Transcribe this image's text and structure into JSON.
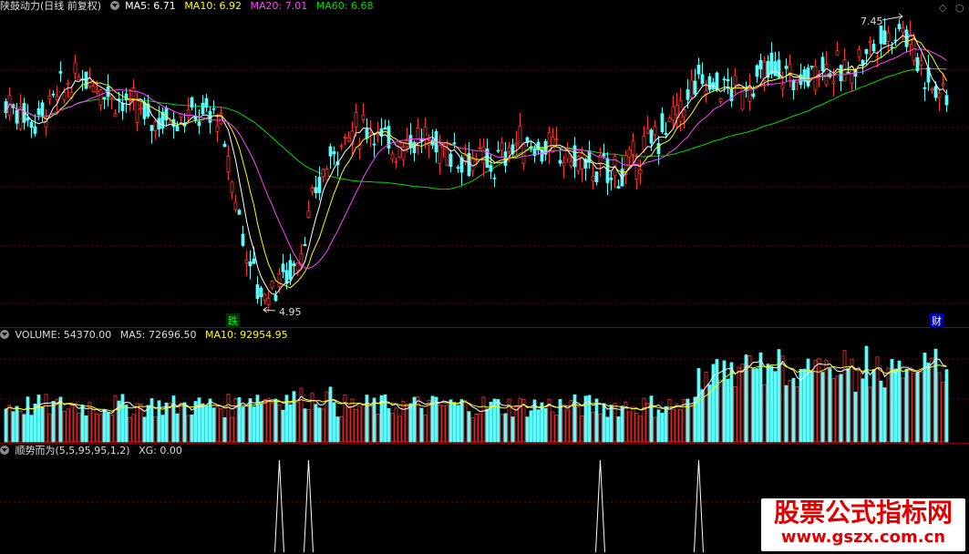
{
  "price_pane": {
    "title": "陕鼓动力(日线 前复权)",
    "ma_labels": [
      {
        "label": "MA5: 6.71",
        "color": "#ffffff"
      },
      {
        "label": "MA10: 6.92",
        "color": "#ffff00"
      },
      {
        "label": "MA20: 7.01",
        "color": "#ff44ff"
      },
      {
        "label": "MA60: 6.68",
        "color": "#00dd00"
      }
    ],
    "high_label": "7.45",
    "low_label": "4.95",
    "event_markers": [
      "跌",
      "财"
    ]
  },
  "volume_pane": {
    "labels": [
      {
        "label": "VOLUME: 54370.00",
        "color": "#dddddd"
      },
      {
        "label": "MA5: 72696.50",
        "color": "#dddddd"
      },
      {
        "label": "MA10: 92954.95",
        "color": "#ffff00"
      }
    ]
  },
  "indicator_pane": {
    "labels": [
      {
        "label": "顺势而为(5,5,95,95,1,2)",
        "color": "#dddddd"
      },
      {
        "label": "XG: 0.00",
        "color": "#dddddd"
      }
    ]
  },
  "watermark": {
    "line1": "股票公式指标网",
    "line2": "www.gszx.com.cn"
  },
  "colors": {
    "up": "#ff3232",
    "down": "#54ffff",
    "grid": "#7a0000",
    "ma5": "#ffffff",
    "ma10": "#ffff00",
    "ma20": "#ff44ff",
    "ma60": "#00dd00"
  },
  "chart_data": {
    "type": "candlestick",
    "price_anchors": {
      "high": 7.45,
      "low": 4.95
    },
    "indicator_signal_bars": [
      75,
      83,
      163,
      190
    ]
  }
}
